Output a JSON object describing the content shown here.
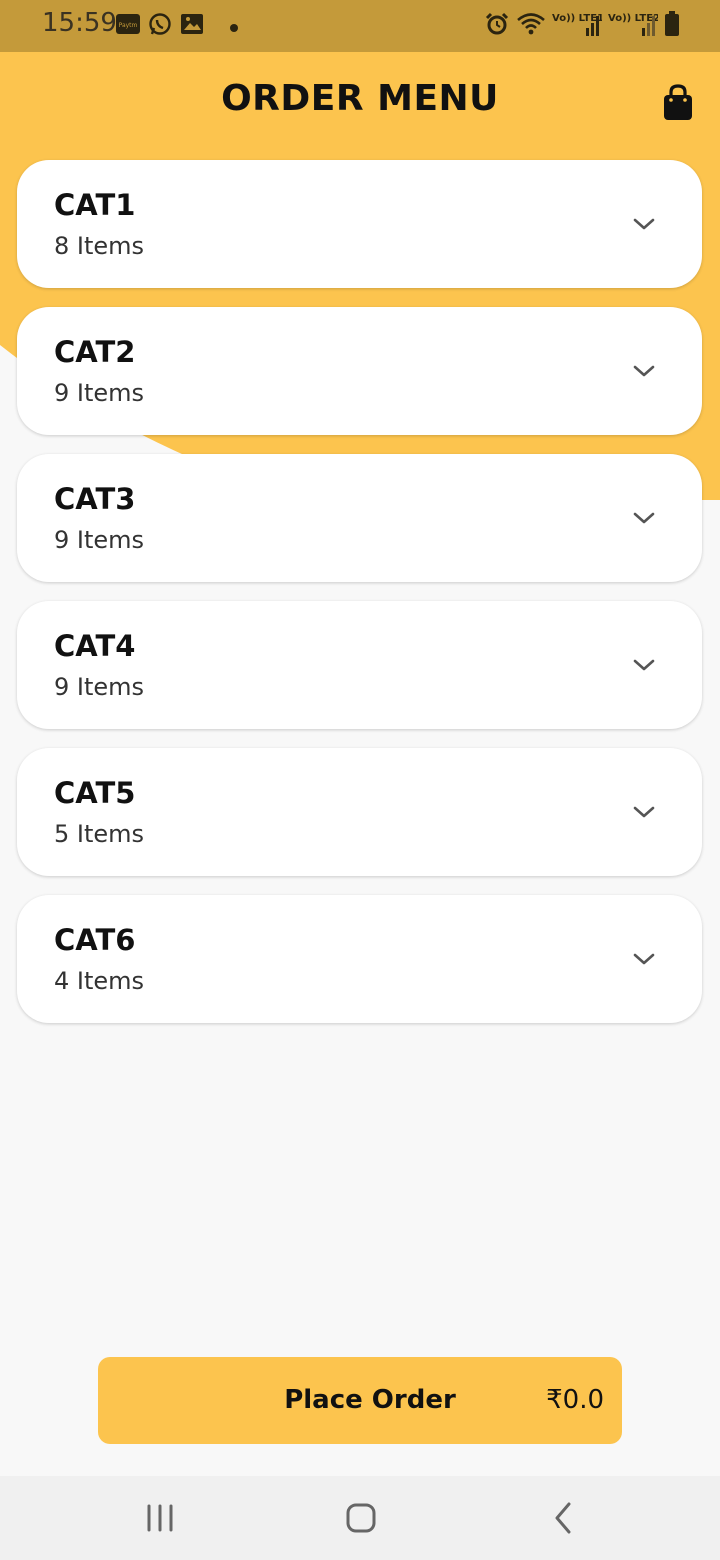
{
  "status_bar": {
    "time": "15:59",
    "icons": [
      "paytm-icon",
      "whatsapp-icon",
      "gallery-icon",
      "notification-dot-icon",
      "alarm-icon",
      "wifi-icon",
      "volte-lte1-signal-icon",
      "volte-lte2-signal-icon",
      "battery-icon"
    ],
    "paytm_label": "Paytm",
    "lte1_label": "Vo)) LTE1",
    "lte2_label": "Vo)) LTE2"
  },
  "header": {
    "title": "ORDER MENU",
    "cart_icon": "shopping-bag-icon"
  },
  "categories": [
    {
      "name": "CAT1",
      "count": "8 Items"
    },
    {
      "name": "CAT2",
      "count": "9 Items"
    },
    {
      "name": "CAT3",
      "count": "9 Items"
    },
    {
      "name": "CAT4",
      "count": "9 Items"
    },
    {
      "name": "CAT5",
      "count": "5 Items"
    },
    {
      "name": "CAT6",
      "count": "4 Items"
    }
  ],
  "footer": {
    "place_order_label": "Place Order",
    "total": "₹0.0"
  },
  "nav_bar": {
    "icons": [
      "recent-apps-icon",
      "home-icon",
      "back-icon"
    ]
  },
  "colors": {
    "accent": "#fcc44e",
    "status_bar": "#c49a3a",
    "background": "#f8f8f8",
    "card": "#ffffff"
  }
}
